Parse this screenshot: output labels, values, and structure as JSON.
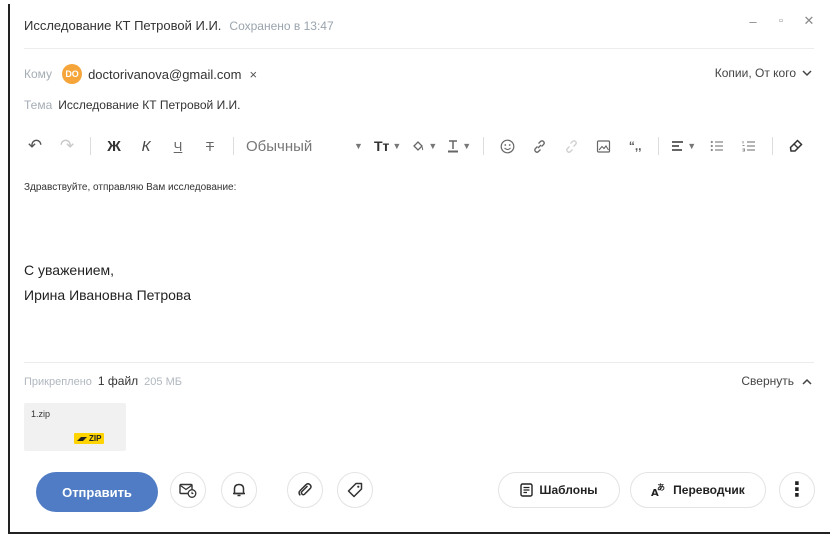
{
  "window": {
    "title": "Исследование КТ Петровой И.И.",
    "saved_status": "Сохранено в 13:47",
    "minimize": "–",
    "restore": "▫",
    "close": "✕"
  },
  "to": {
    "label": "Кому",
    "recipient_initials": "DO",
    "recipient_email": "doctorivanova@gmail.com",
    "remove": "×",
    "copies_label": "Копии, От кого"
  },
  "subject": {
    "label": "Тема",
    "value": "Исследование КТ Петровой И.И."
  },
  "toolbar": {
    "undo": "↶",
    "redo": "↷",
    "bold": "Ж",
    "italic": "К",
    "underline": "Ч",
    "strike": "Т",
    "text_style": "Обычный",
    "font_size": "Tт",
    "quote": "“,,"
  },
  "message": {
    "greeting": "Здравствуйте, отправляю Вам исследование:",
    "closing": "С уважением,",
    "signature": "Ирина Ивановна Петрова"
  },
  "attachments": {
    "label": "Прикреплено",
    "count": "1 файл",
    "size": "205 МБ",
    "collapse_label": "Свернуть",
    "files": [
      {
        "name": "1.zip",
        "type": "ZIP"
      }
    ]
  },
  "actions": {
    "send": "Отправить",
    "templates": "Шаблоны",
    "translator": "Переводчик",
    "more": "⋮"
  },
  "colors": {
    "send_button": "#4f7cc4",
    "avatar": "#f5a53a",
    "zip_badge": "#ffd400"
  }
}
